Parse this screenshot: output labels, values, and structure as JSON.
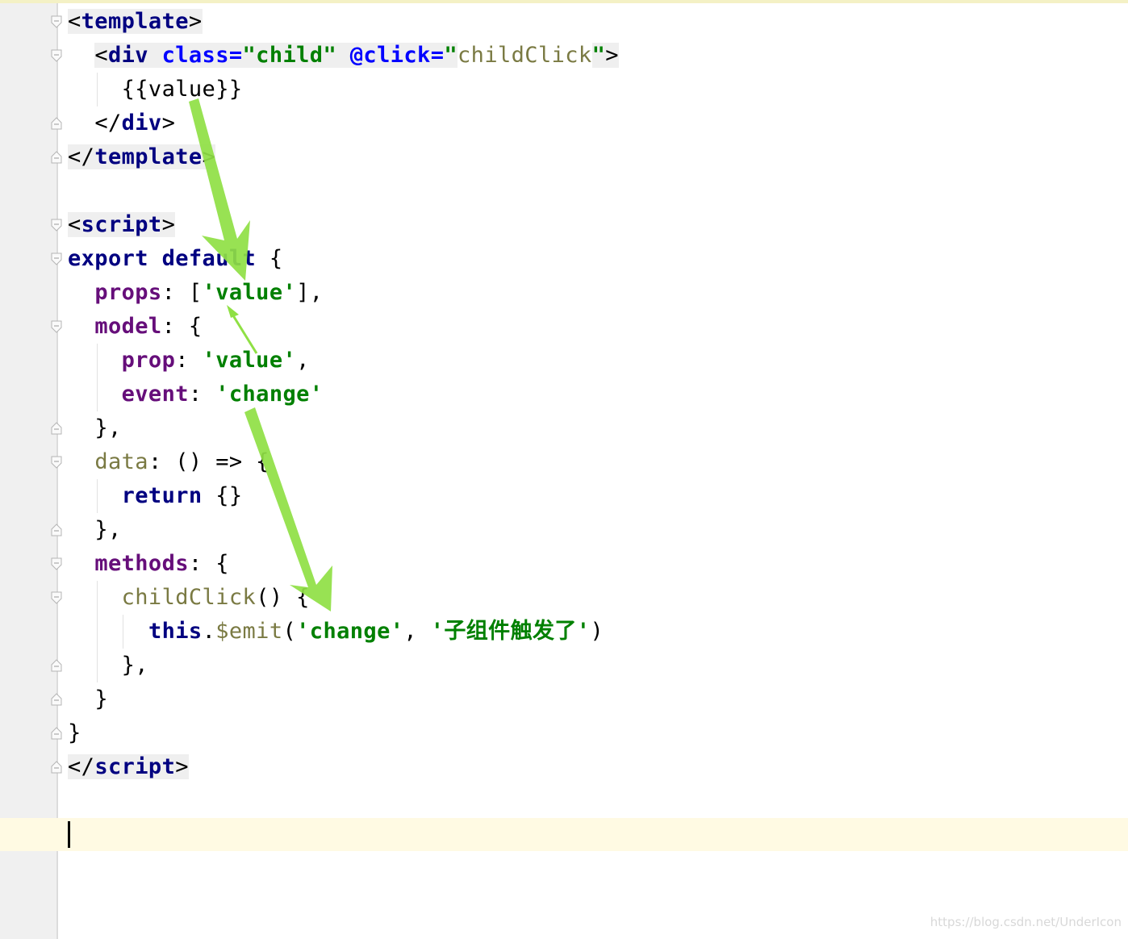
{
  "editor": {
    "lines": {
      "l1_open": "<",
      "l1_tag": "template",
      "l1_close": ">",
      "l2_open": "<",
      "l2_tag": "div",
      "l2_attr1": "class=",
      "l2_val1": "\"child\"",
      "l2_attr2": "@click=",
      "l2_q1": "\"",
      "l2_val2": "childClick",
      "l2_q2": "\"",
      "l2_close": ">",
      "l3_text": "{{value}}",
      "l4_open": "</",
      "l4_tag": "div",
      "l4_close": ">",
      "l5_open": "</",
      "l5_tag": "template",
      "l5_close": ">",
      "l7_open": "<",
      "l7_tag": "script",
      "l7_close": ">",
      "l8_kw": "export default",
      "l8_rest": " {",
      "l9_key": "props",
      "l9_p1": ": [",
      "l9_str": "'value'",
      "l9_p2": "],",
      "l10_key": "model",
      "l10_rest": ": {",
      "l11_key": "prop",
      "l11_p1": ": ",
      "l11_str": "'value'",
      "l11_p2": ",",
      "l12_key": "event",
      "l12_p1": ": ",
      "l12_str": "'change'",
      "l13_text": "},",
      "l14_key": "data",
      "l14_rest": ": () => {",
      "l15_kw": "return",
      "l15_rest": " {}",
      "l16_text": "},",
      "l17_key": "methods",
      "l17_rest": ": {",
      "l18_fn": "childClick",
      "l18_rest": "() {",
      "l19_kw": "this",
      "l19_dot": ".",
      "l19_fn": "$emit",
      "l19_p1": "(",
      "l19_str1": "'change'",
      "l19_p2": ", ",
      "l19_str2": "'子组件触发了'",
      "l19_p3": ")",
      "l20_text": "},",
      "l21_text": "}",
      "l22_text": "}",
      "l23_open": "</",
      "l23_tag": "script",
      "l23_close": ">"
    },
    "colors": {
      "tag": "#000080",
      "attribute": "#0000ff",
      "string": "#008000",
      "property": "#660e7a",
      "function": "#7a7a43",
      "arrow": "#8fe044",
      "caret_row": "#fffae3",
      "gutter": "#f0f0f0"
    }
  },
  "annotations": {
    "arrows": [
      "big-arrow-template-to-props",
      "thin-arrow-prop-to-props",
      "big-arrow-event-to-emit"
    ]
  },
  "watermark": "https://blog.csdn.net/UnderIcon"
}
